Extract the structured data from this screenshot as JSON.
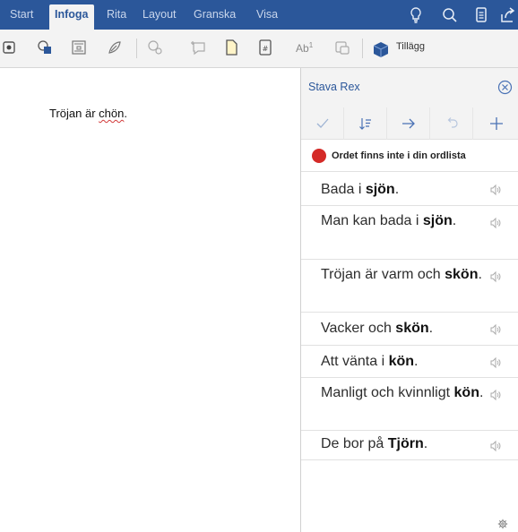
{
  "ribbon": {
    "tabs": [
      {
        "label": "Start",
        "active": false
      },
      {
        "label": "Infoga",
        "active": true
      },
      {
        "label": "Rita",
        "active": false
      },
      {
        "label": "Layout",
        "active": false
      },
      {
        "label": "Granska",
        "active": false
      },
      {
        "label": "Visa",
        "active": false
      }
    ],
    "right_icons": [
      "lightbulb-icon",
      "search-icon",
      "document-icon",
      "share-icon"
    ]
  },
  "toolbar": {
    "icons": [
      "text-box-icon",
      "shapes-icon",
      "table-icon",
      "picture-icon",
      "online-picture-icon",
      "comment-icon",
      "header-icon",
      "page-number-icon",
      "footnote-icon",
      "wordart-icon",
      "addins-icon"
    ],
    "footnote_text": "Ab",
    "footnote_sup": "1",
    "addins_label": "Tillägg"
  },
  "document": {
    "text_before": "Tröjan är ",
    "misspelled_word": "chön",
    "text_after": "."
  },
  "panel": {
    "title": "Stava Rex",
    "toolbar_icons": [
      "check-icon",
      "sort-icon",
      "arrow-right-icon",
      "undo-icon",
      "plus-icon"
    ],
    "notice": "Ordet finns inte i din ordlista",
    "suggestions": [
      {
        "before": "Bada i ",
        "word": "sjön",
        "after": "."
      },
      {
        "before": "Man kan bada i ",
        "word": "sjön",
        "after": "."
      },
      {
        "before": "Tröjan är varm och ",
        "word": "skön",
        "after": "."
      },
      {
        "before": "Vacker och ",
        "word": "skön",
        "after": "."
      },
      {
        "before": "Att vänta i ",
        "word": "kön",
        "after": "."
      },
      {
        "before": "Manligt och kvinnligt ",
        "word": "kön",
        "after": "."
      },
      {
        "before": "De bor på ",
        "word": "Tjörn",
        "after": "."
      }
    ]
  },
  "colors": {
    "ribbon": "#2b579a",
    "accent": "#2b579a",
    "notice_dot": "#d42a27"
  }
}
